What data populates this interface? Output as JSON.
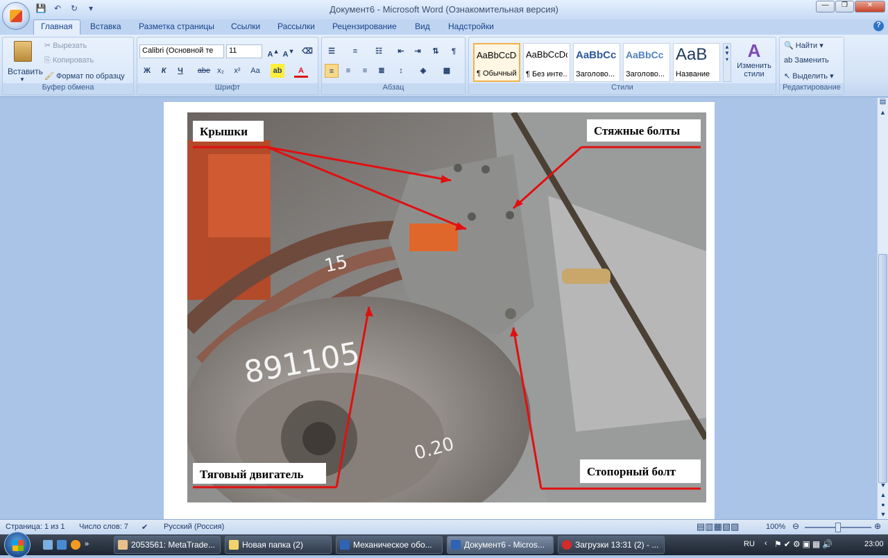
{
  "window": {
    "title": "Документ6 - Microsoft Word (Ознакомительная версия)"
  },
  "tabs": [
    "Главная",
    "Вставка",
    "Разметка страницы",
    "Ссылки",
    "Рассылки",
    "Рецензирование",
    "Вид",
    "Надстройки"
  ],
  "clipboard": {
    "paste_label": "Вставить",
    "cut_label": "Вырезать",
    "copy_label": "Копировать",
    "format_painter_label": "Формат по образцу",
    "group_label": "Буфер обмена"
  },
  "font": {
    "font_name": "Calibri (Основной те",
    "font_size": "11",
    "group_label": "Шрифт",
    "bold": "Ж",
    "italic": "К",
    "underline": "Ч",
    "strike": "abe",
    "subscript": "x₂",
    "superscript": "x²",
    "case": "Aa"
  },
  "paragraph": {
    "group_label": "Абзац"
  },
  "styles": {
    "group_label": "Стили",
    "tiles": [
      {
        "sample": "AaBbCcDc",
        "name": "¶ Обычный"
      },
      {
        "sample": "AaBbCcDc",
        "name": "¶ Без инте..."
      },
      {
        "sample": "AaBbCc",
        "name": "Заголово..."
      },
      {
        "sample": "AaBbCc",
        "name": "Заголово..."
      },
      {
        "sample": "AaB",
        "name": "Название"
      }
    ],
    "change_styles_label_1": "Изменить",
    "change_styles_label_2": "стили"
  },
  "editing": {
    "group_label": "Редактирование",
    "find_label": "Найти",
    "replace_label": "Заменить",
    "select_label": "Выделить"
  },
  "figure": {
    "labels": {
      "covers": "Крышки",
      "tie_bolts": "Стяжные болты",
      "traction_motor": "Тяговый двигатель",
      "lock_bolt": "Стопорный болт"
    },
    "chalk_text_1": "15",
    "chalk_text_2": "891105",
    "chalk_text_3": "0.20",
    "arrow_color": "#e01010"
  },
  "status": {
    "page": "Страница: 1 из 1",
    "words": "Число слов: 7",
    "language": "Русский (Россия)",
    "zoom": "100%"
  },
  "taskbar": {
    "items": [
      "2053561: MetaTrade...",
      "Новая папка (2)",
      "Механическое обо...",
      "Документ6 - Micros...",
      "Загрузки 13:31 (2) - ..."
    ],
    "lang": "RU",
    "clock": "23:00"
  }
}
